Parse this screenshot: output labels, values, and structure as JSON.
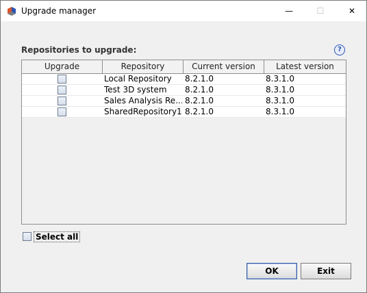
{
  "window": {
    "title": "Upgrade manager",
    "controls": {
      "minimize": "—",
      "maximize": "☐",
      "close": "✕"
    }
  },
  "section": {
    "label": "Repositories to upgrade:",
    "help": "?"
  },
  "table": {
    "headers": [
      "Upgrade",
      "Repository",
      "Current version",
      "Latest version"
    ],
    "rows": [
      {
        "checked": false,
        "repository": "Local Repository",
        "current": "8.2.1.0",
        "latest": "8.3.1.0"
      },
      {
        "checked": false,
        "repository": "Test 3D system",
        "current": "8.2.1.0",
        "latest": "8.3.1.0"
      },
      {
        "checked": false,
        "repository": "Sales Analysis Re...",
        "current": "8.2.1.0",
        "latest": "8.3.1.0"
      },
      {
        "checked": false,
        "repository": "SharedRepository1",
        "current": "8.2.1.0",
        "latest": "8.3.1.0"
      }
    ]
  },
  "select_all": {
    "label": "Select all",
    "checked": false
  },
  "buttons": {
    "ok": "OK",
    "exit": "Exit"
  }
}
